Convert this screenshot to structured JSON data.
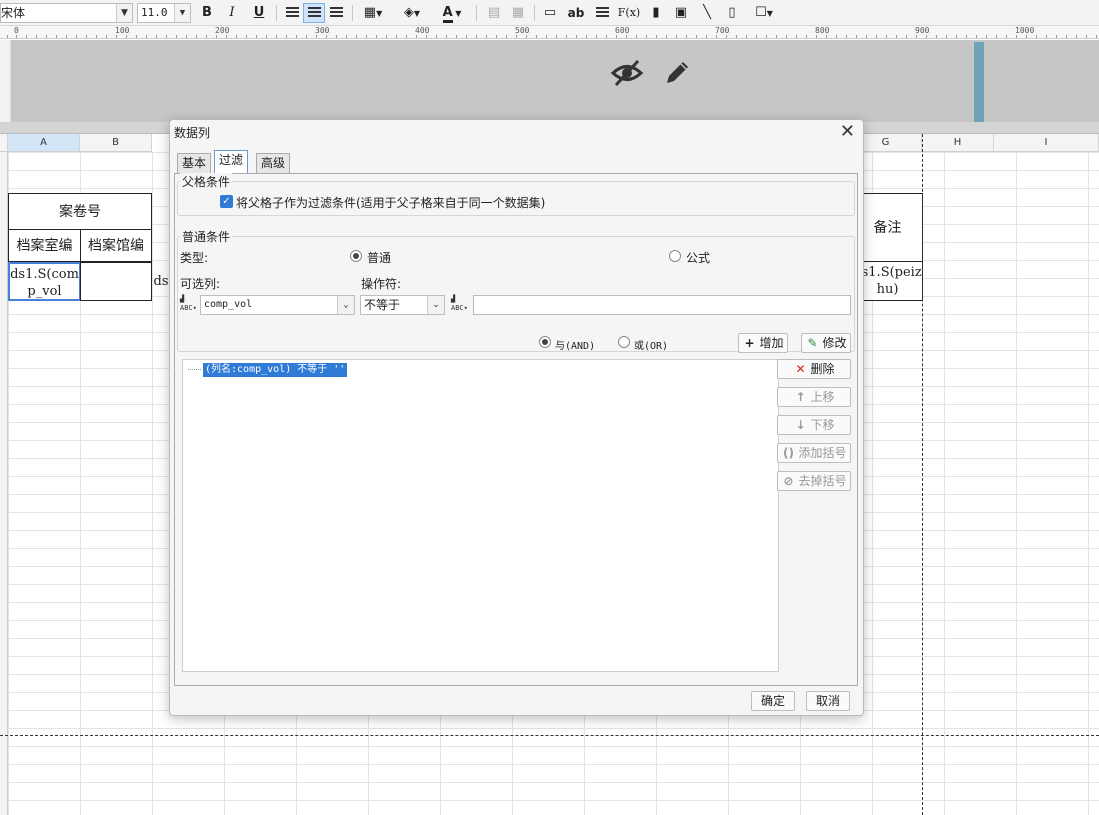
{
  "toolbar": {
    "font_name": "宋体",
    "font_size": "11.0",
    "bold_label": "B",
    "italic_label": "I",
    "underline_label": "U",
    "font_color_label": "A",
    "text_label": "ab",
    "formula_label": "F(x)"
  },
  "ruler": {
    "labels": [
      "0",
      "100",
      "200",
      "300",
      "400",
      "500",
      "600",
      "700",
      "800",
      "900",
      "1000"
    ]
  },
  "sheet": {
    "columns": [
      "A",
      "B",
      "G",
      "H",
      "I"
    ],
    "cells": {
      "juan_hao": "案卷号",
      "dang_an_shi": "档案室编",
      "dang_an_guan": "档案馆编",
      "a_formula": "ds1.S(comp_vol",
      "c_fragment": "ds",
      "bei_zhu": "备注",
      "g_formula": "ds1.S(peizhu)"
    }
  },
  "dialog": {
    "title": "数据列",
    "tabs": [
      "基本",
      "过滤",
      "高级"
    ],
    "active_tab": "过滤",
    "parent": {
      "group_title": "父格条件",
      "checkbox_label": "将父格子作为过滤条件(适用于父子格来自于同一个数据集)",
      "checked": true
    },
    "normal": {
      "group_title": "普通条件",
      "type_label": "类型:",
      "radio_normal": "普通",
      "radio_formula": "公式",
      "selected_type": "普通",
      "column_label": "可选列:",
      "operator_label": "操作符:",
      "column_value": "comp_vol",
      "operator_value": "不等于",
      "value_input": "",
      "and_label": "与(AND)",
      "or_label": "或(OR)",
      "selected_join": "与(AND)",
      "add_button": "增加",
      "modify_button": "修改"
    },
    "conditions": [
      "(列名:comp_vol) 不等于 ''"
    ],
    "side_buttons": {
      "delete": "删除",
      "up": "上移",
      "down": "下移",
      "add_bracket": "添加括号",
      "remove_bracket": "去掉括号"
    },
    "ok": "确定",
    "cancel": "取消"
  }
}
